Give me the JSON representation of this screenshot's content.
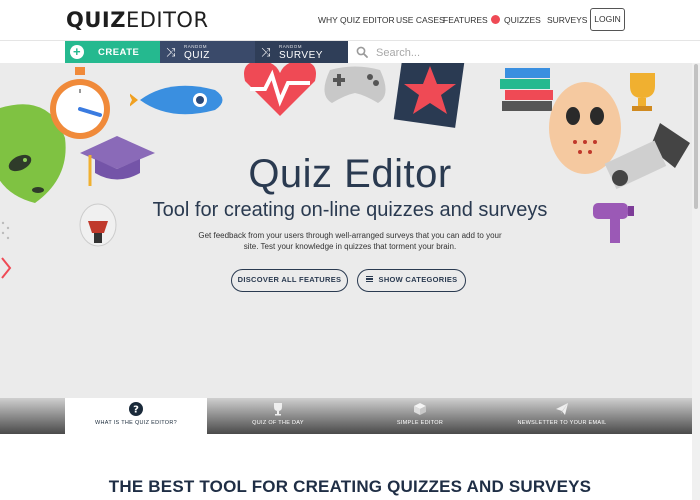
{
  "header": {
    "logo_bold": "QUIZ",
    "logo_rest": "EDITOR",
    "nav": [
      {
        "label": "WHY QUIZ EDITOR"
      },
      {
        "label": "USE CASES"
      },
      {
        "label": "FEATURES"
      },
      {
        "label": "QUIZZES"
      },
      {
        "label": "SURVEYS"
      }
    ],
    "login_label": "LOGIN",
    "quiz_dot_color": "#ef4a55"
  },
  "toolbar": {
    "create_label": "CREATE",
    "random_quiz_small": "RANDOM",
    "random_quiz_big": "QUIZ",
    "random_survey_small": "RANDOM",
    "random_survey_big": "SURVEY",
    "search_placeholder": "Search...",
    "create_color": "#25b98f"
  },
  "hero": {
    "title": "Quiz Editor",
    "subtitle": "Tool for creating on-line quizzes and surveys",
    "description": "Get feedback from your users through well-arranged surveys that you can add to your site. Test your knowledge in quizzes that torment your brain.",
    "discover_label": "DISCOVER ALL FEATURES",
    "categories_label": "SHOW CATEGORIES"
  },
  "tabs": [
    {
      "label": "WHAT IS THE QUIZ EDITOR?",
      "icon": "question-icon"
    },
    {
      "label": "QUIZ OF THE DAY",
      "icon": "trophy-icon"
    },
    {
      "label": "SIMPLE EDITOR",
      "icon": "box-icon"
    },
    {
      "label": "NEWSLETTER TO YOUR EMAIL",
      "icon": "paper-plane-icon"
    }
  ],
  "section_heading": "THE BEST TOOL FOR CREATING QUIZZES AND SURVEYS"
}
